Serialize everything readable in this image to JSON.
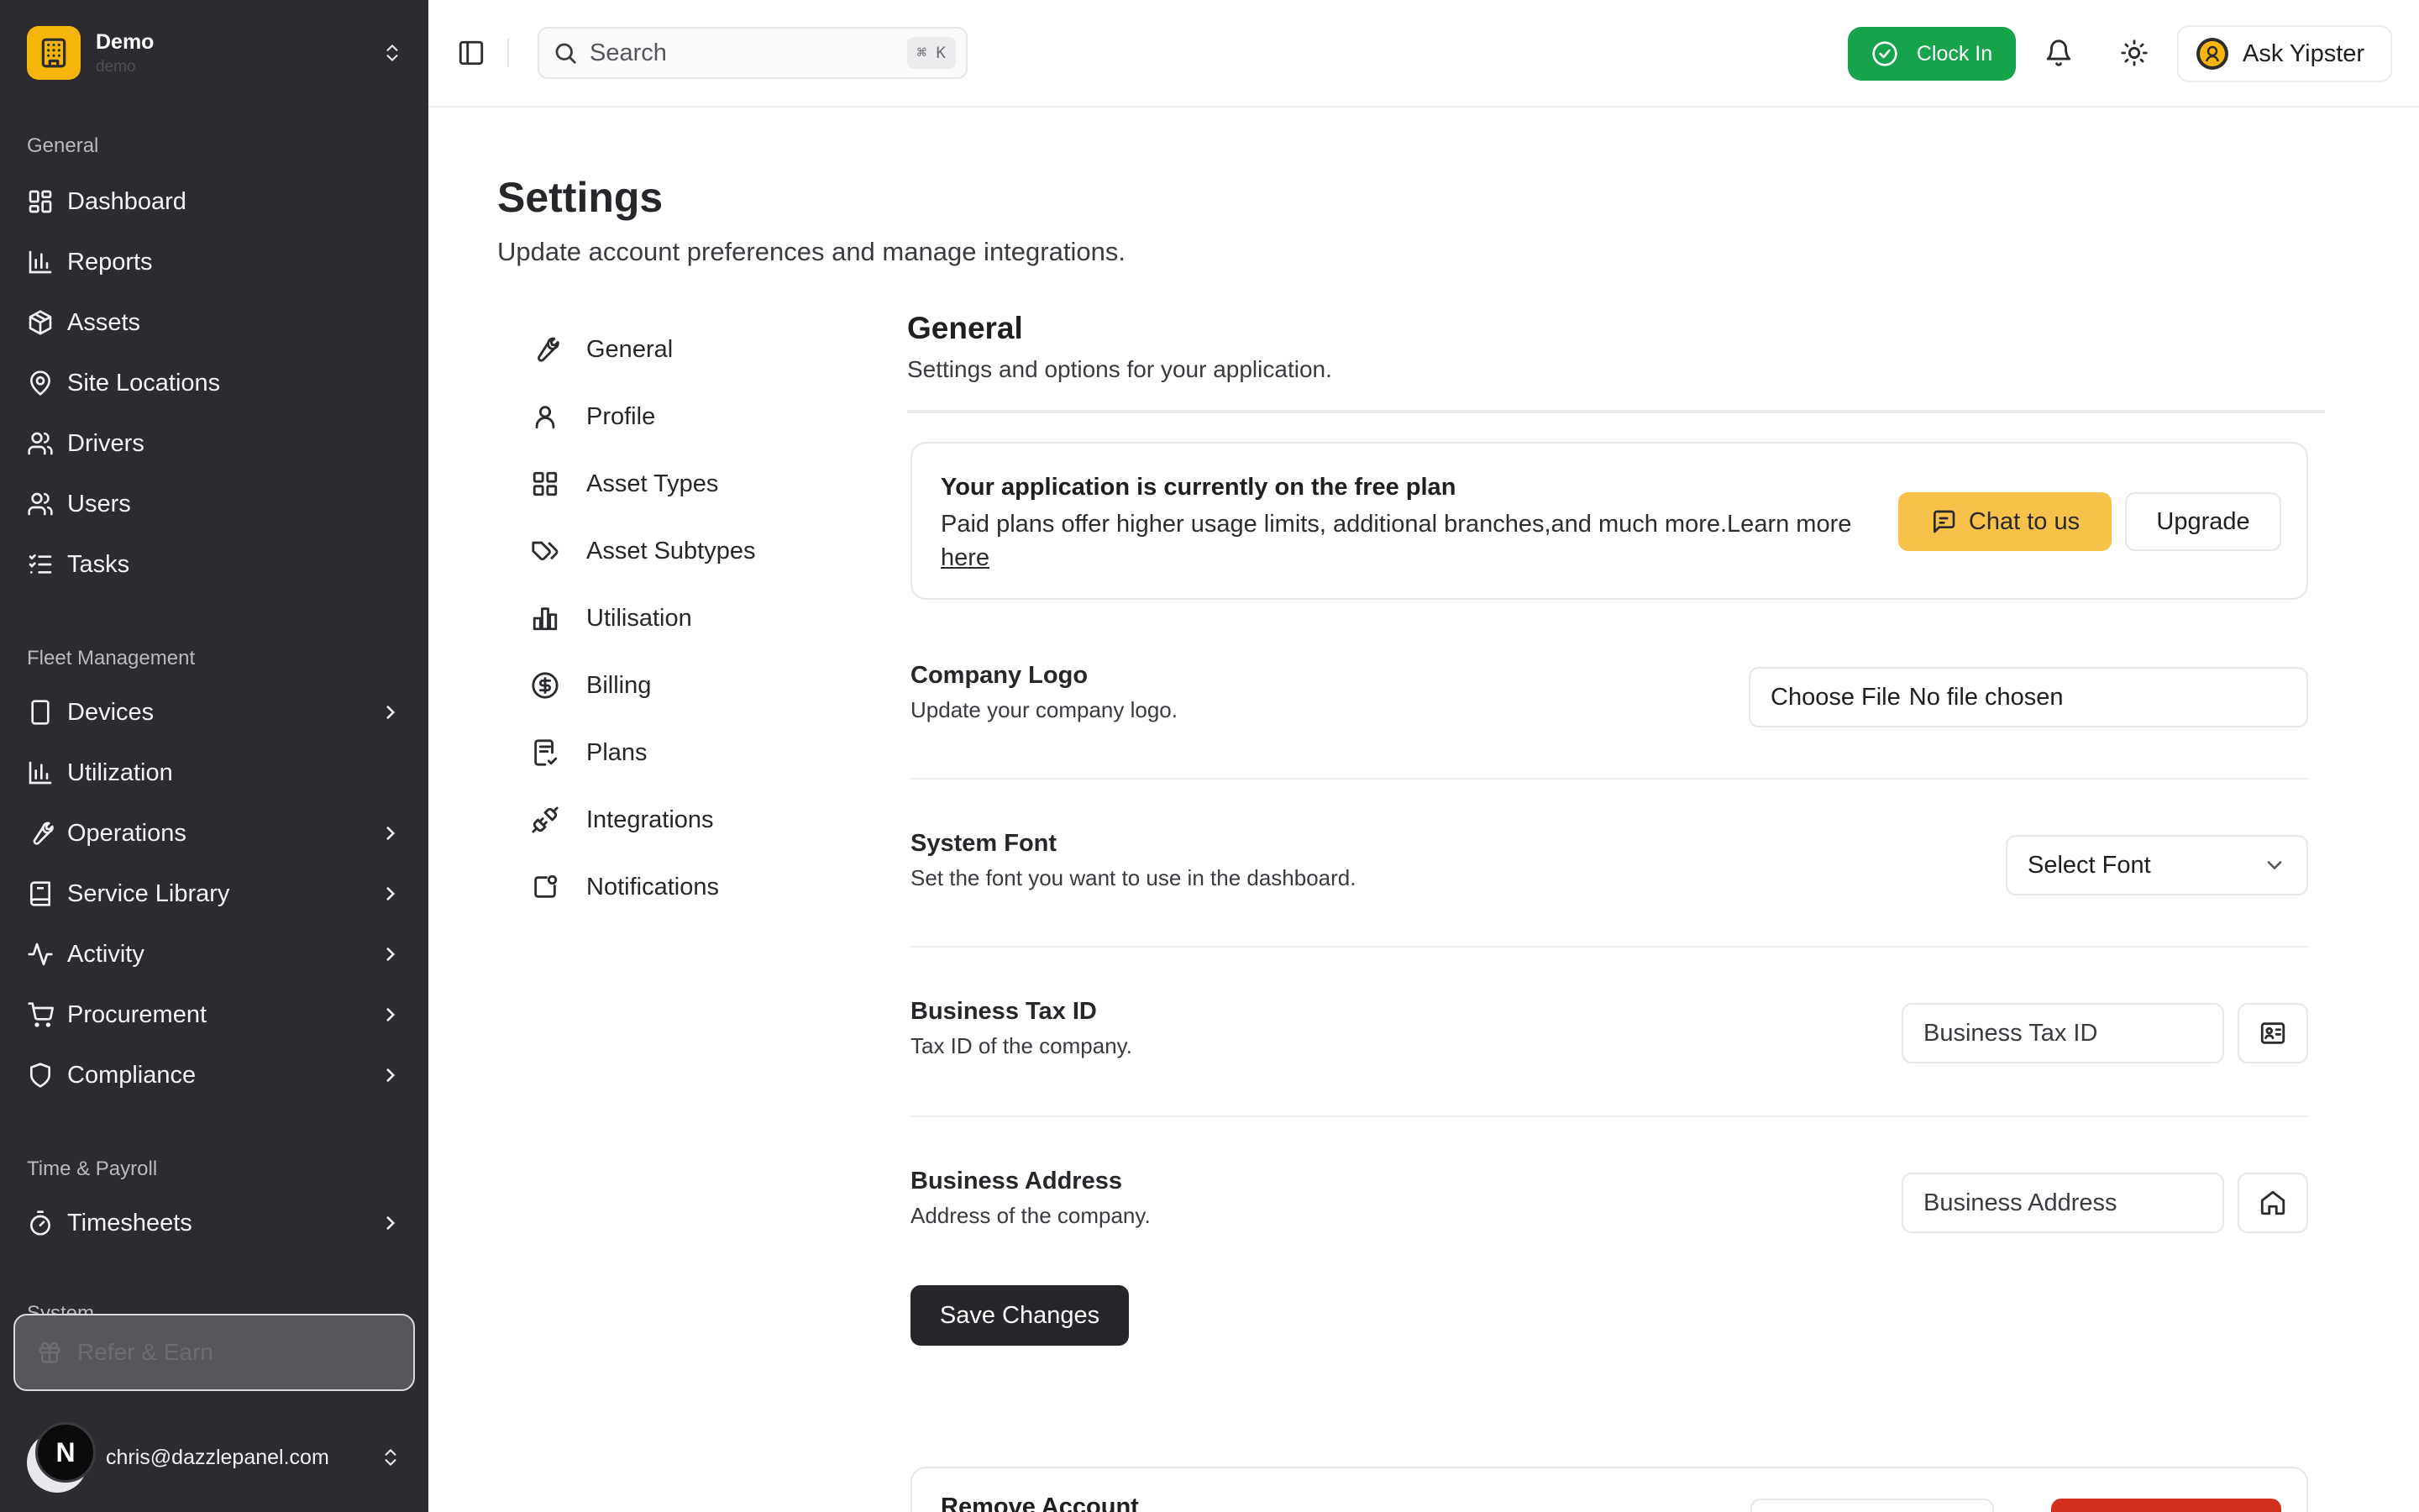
{
  "org": {
    "name": "Demo",
    "sub": "demo"
  },
  "nav_groups": {
    "general": "General",
    "fleet": "Fleet Management",
    "time": "Time & Payroll",
    "system": "System"
  },
  "nav": {
    "dashboard": "Dashboard",
    "reports": "Reports",
    "assets": "Assets",
    "site_locations": "Site Locations",
    "drivers": "Drivers",
    "users": "Users",
    "tasks": "Tasks",
    "devices": "Devices",
    "utilization": "Utilization",
    "operations": "Operations",
    "service_library": "Service Library",
    "activity": "Activity",
    "procurement": "Procurement",
    "compliance": "Compliance",
    "timesheets": "Timesheets",
    "refer": "Refer & Earn"
  },
  "user": {
    "initial": "N",
    "email": "chris@dazzlepanel.com"
  },
  "topbar": {
    "search_placeholder": "Search",
    "shortcut": "⌘ K",
    "clock_in": "Clock In",
    "ask": "Ask Yipster"
  },
  "page": {
    "title": "Settings",
    "subtitle": "Update account preferences and manage integrations."
  },
  "settings_nav": {
    "general": "General",
    "profile": "Profile",
    "asset_types": "Asset Types",
    "asset_subtypes": "Asset Subtypes",
    "utilisation": "Utilisation",
    "billing": "Billing",
    "plans": "Plans",
    "integrations": "Integrations",
    "notifications": "Notifications"
  },
  "section": {
    "title": "General",
    "subtitle": "Settings and options for your application."
  },
  "plan": {
    "title": "Your application is currently on the free plan",
    "body": "Paid plans offer higher usage limits, additional branches,and much more.Learn more ",
    "link": "here",
    "chat": "Chat to us",
    "upgrade": "Upgrade"
  },
  "logo": {
    "label": "Company Logo",
    "desc": "Update your company logo.",
    "choose": "Choose File",
    "status": "No file chosen"
  },
  "font": {
    "label": "System Font",
    "desc": "Set the font you want to use in the dashboard.",
    "value": "Select Font"
  },
  "tax": {
    "label": "Business Tax ID",
    "desc": "Tax ID of the company.",
    "placeholder": "Business Tax ID"
  },
  "address": {
    "label": "Business Address",
    "desc": "Address of the company.",
    "placeholder": "Business Address"
  },
  "save": "Save Changes",
  "danger": {
    "title": "Remove Account"
  },
  "colors": {
    "sidebar_bg": "#2b2b30",
    "brand": "#f5b50a",
    "clock_in": "#16a34a",
    "chat_btn": "#f8c14a",
    "danger": "#d32f1f"
  },
  "icons": {
    "org": "building-icon",
    "ask": "yipster-logo-icon"
  }
}
